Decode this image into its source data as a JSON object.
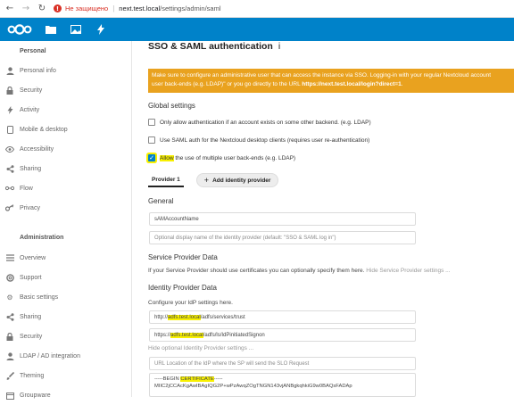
{
  "browser": {
    "insecure_label": "Не защищено",
    "url_host": "next.test.local",
    "url_path": "/settings/admin/saml"
  },
  "header": {
    "apps": [
      "files-icon",
      "photos-icon",
      "activity-icon"
    ]
  },
  "sidebar": {
    "personal_heading": "Personal",
    "personal_items": [
      {
        "label": "Personal info",
        "icon": "user-icon"
      },
      {
        "label": "Security",
        "icon": "lock-icon"
      },
      {
        "label": "Activity",
        "icon": "activity-icon"
      },
      {
        "label": "Mobile & desktop",
        "icon": "phone-icon"
      },
      {
        "label": "Accessibility",
        "icon": "eye-icon"
      },
      {
        "label": "Sharing",
        "icon": "share-icon"
      },
      {
        "label": "Flow",
        "icon": "flow-icon"
      },
      {
        "label": "Privacy",
        "icon": "key-icon"
      }
    ],
    "admin_heading": "Administration",
    "admin_items": [
      {
        "label": "Overview",
        "icon": "list-icon"
      },
      {
        "label": "Support",
        "icon": "support-icon"
      },
      {
        "label": "Basic settings",
        "icon": "gear-icon"
      },
      {
        "label": "Sharing",
        "icon": "share-icon"
      },
      {
        "label": "Security",
        "icon": "lock-icon"
      },
      {
        "label": "LDAP / AD integration",
        "icon": "user-icon"
      },
      {
        "label": "Theming",
        "icon": "brush-icon"
      },
      {
        "label": "Groupware",
        "icon": "groupware-icon"
      }
    ]
  },
  "main": {
    "title": "SSO & SAML authentication",
    "info_glyph": "i",
    "warning_line1": "Make sure to configure an administrative user that can access the instance via SSO. Logging-in with your regular Nextcloud account",
    "warning_line2_pre": "user back-ends (e.g. LDAP)\" or you go directly to the URL ",
    "warning_url": "https://next.test.local/login?direct=1",
    "global_settings": "Global settings",
    "checkboxes": [
      {
        "label": "Only allow authentication if an account exists on some other backend. (e.g. LDAP)",
        "checked": false
      },
      {
        "label": "Use SAML auth for the Nextcloud desktop clients (requires user re-authentication)",
        "checked": false
      },
      {
        "label": "Allow the use of multiple user back-ends (e.g. LDAP)",
        "checked": true
      }
    ],
    "tab_provider": "Provider 1",
    "add_provider": "Add identity provider",
    "general_heading": "General",
    "uid_field": "sAMAccountName",
    "display_name_placeholder": "Optional display name of the identity provider (default: \"SSO & SAML log in\")",
    "sp_heading": "Service Provider Data",
    "sp_desc": "If your Service Provider should use certificates you can optionally specify them here.",
    "sp_hide": "Hide Service Provider settings ...",
    "idp_heading": "Identity Provider Data",
    "idp_desc": "Configure your IdP settings here.",
    "idp_entity_pre": "http://",
    "idp_entity_hl": "adfs.test.local",
    "idp_entity_post": "/adfs/services/trust",
    "idp_sso_pre": "https://",
    "idp_sso_hl": "adfs.test.local",
    "idp_sso_post": "/adfs/ls/IdPinitiatedSignon",
    "idp_hide": "Hide optional Identity Provider settings ...",
    "slo_placeholder": "URL Location of the IdP where the SP will send the SLO Request",
    "cert_line1_pre": "-----BEGIN ",
    "cert_line1_hl": "CERTIFICATE",
    "cert_line1_post": "-----",
    "cert_line2": "MIIC2jCCAcKgAwIBAgIQG2P+wPzAwqZOgTNGN143vjANBgkqhkiG9w0BAQsFADAp"
  }
}
